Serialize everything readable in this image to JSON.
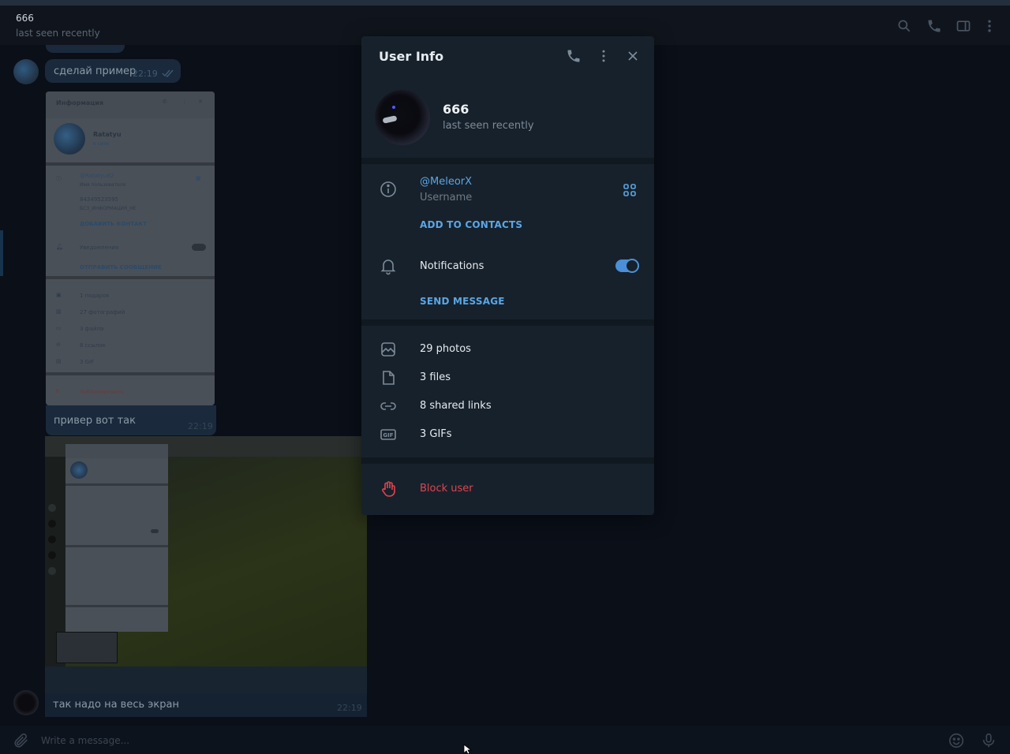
{
  "chat": {
    "title": "666",
    "status": "last seen recently",
    "messages": [
      {
        "text": "сделай пример",
        "time": "22:19"
      },
      {
        "text": "привер вот так",
        "time": "22:19"
      },
      {
        "text": "так надо на весь экран",
        "time": "22:19"
      }
    ],
    "composer_placeholder": "Write a message..."
  },
  "screenshot_preview": {
    "title": "Информация",
    "name": "Ratatyu",
    "status": "в сети",
    "username": "@Ratatyu82",
    "username_sub": "Имя пользователя",
    "phone": "84349523595",
    "phone_sub": "БСЗ_ИНФОРМАЦИЯ_НЕ",
    "add_contact": "ДОБАВИТЬ КОНТАКТ",
    "notifications": "Уведомления",
    "send_message": "ОТПРАВИТЬ СООБЩЕНИЕ",
    "media": [
      "1 подарок",
      "27 фотографий",
      "3 файла",
      "8 ссылок",
      "3 GIF"
    ],
    "block": "Заблокировать"
  },
  "panel": {
    "title": "User Info",
    "name": "666",
    "status": "last seen recently",
    "username": "@MeleorX",
    "username_label": "Username",
    "add_to_contacts": "ADD TO CONTACTS",
    "notifications_label": "Notifications",
    "notifications_on": true,
    "send_message": "SEND MESSAGE",
    "media": {
      "photos": "29 photos",
      "files": "3 files",
      "links": "8 shared links",
      "gifs": "3 GIFs"
    },
    "block": "Block user"
  },
  "colors": {
    "accent": "#5aa6e6",
    "danger": "#e0444e",
    "panel_bg": "#17212b"
  }
}
